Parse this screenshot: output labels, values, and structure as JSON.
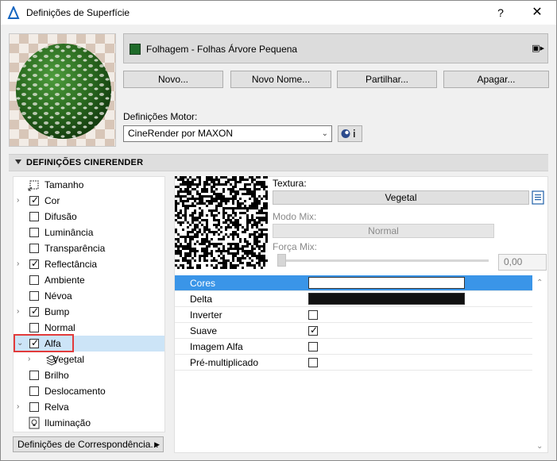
{
  "window": {
    "title": "Definições de Superfície",
    "help_label": "?",
    "close_label": "✕"
  },
  "surface": {
    "name": "Folhagem - Folhas Árvore Pequena",
    "color": "#1f6b2a"
  },
  "buttons": {
    "new": "Novo...",
    "new_name": "Novo Nome...",
    "share": "Partilhar...",
    "delete": "Apagar..."
  },
  "engine": {
    "label": "Definições Motor:",
    "value": "CineRender por MAXON"
  },
  "section": {
    "title": "DEFINIÇÕES CINERENDER"
  },
  "tree": [
    {
      "label": "Tamanho",
      "kind": "icon",
      "icon": "size-icon",
      "chevron": false
    },
    {
      "label": "Cor",
      "kind": "check",
      "checked": true,
      "chevron": true
    },
    {
      "label": "Difusão",
      "kind": "check",
      "checked": false,
      "chevron": false
    },
    {
      "label": "Luminância",
      "kind": "check",
      "checked": false,
      "chevron": false
    },
    {
      "label": "Transparência",
      "kind": "check",
      "checked": false,
      "chevron": false
    },
    {
      "label": "Reflectância",
      "kind": "check",
      "checked": true,
      "chevron": true
    },
    {
      "label": "Ambiente",
      "kind": "check",
      "checked": false,
      "chevron": false
    },
    {
      "label": "Névoa",
      "kind": "check",
      "checked": false,
      "chevron": false
    },
    {
      "label": "Bump",
      "kind": "check",
      "checked": true,
      "chevron": true
    },
    {
      "label": "Normal",
      "kind": "check",
      "checked": false,
      "chevron": false
    },
    {
      "label": "Alfa",
      "kind": "check",
      "checked": true,
      "chevron": true,
      "expanded": true,
      "selected": true
    },
    {
      "label": "Vegetal",
      "kind": "child",
      "icon": "layers-icon",
      "chevron": true
    },
    {
      "label": "Brilho",
      "kind": "check",
      "checked": false,
      "chevron": false
    },
    {
      "label": "Deslocamento",
      "kind": "check",
      "checked": false,
      "chevron": false
    },
    {
      "label": "Relva",
      "kind": "check",
      "checked": false,
      "chevron": true
    },
    {
      "label": "Iluminação",
      "kind": "icon",
      "icon": "lightbulb-icon",
      "chevron": false
    }
  ],
  "mapping_button": "Definições de Correspondência...",
  "texture": {
    "label": "Textura:",
    "name": "Vegetal",
    "mix_mode_label": "Modo Mix:",
    "mix_mode_value": "Normal",
    "mix_force_label": "Força Mix:",
    "mix_force_value": "0,00"
  },
  "properties": [
    {
      "label": "Cores",
      "kind": "color",
      "color": "#ffffff",
      "selected": true
    },
    {
      "label": "Delta",
      "kind": "color",
      "color": "#111111",
      "selected": false
    },
    {
      "label": "Inverter",
      "kind": "check",
      "checked": false
    },
    {
      "label": "Suave",
      "kind": "check",
      "checked": true
    },
    {
      "label": "Imagem Alfa",
      "kind": "check",
      "checked": false
    },
    {
      "label": "Pré-multiplicado",
      "kind": "check",
      "checked": false
    }
  ]
}
